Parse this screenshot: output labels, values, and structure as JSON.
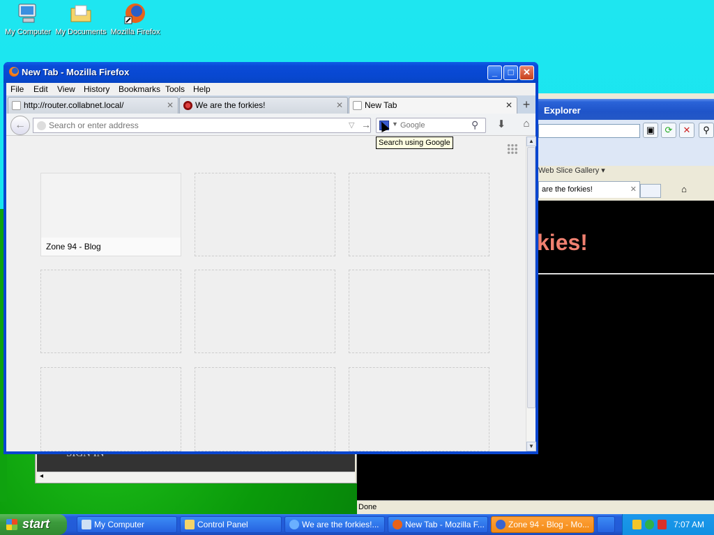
{
  "desktop": {
    "icons": [
      {
        "label": "My Computer"
      },
      {
        "label": "My Documents"
      },
      {
        "label": "Mozilla Firefox"
      }
    ]
  },
  "ie_window": {
    "title": "Explorer",
    "links_label": "Web Slice Gallery",
    "tab_title": "are the forkies!",
    "page_heading": "kies!",
    "status": "Done"
  },
  "zone_window": {
    "sign_in": "SIGN IN"
  },
  "firefox": {
    "title": "New Tab - Mozilla Firefox",
    "menu": [
      "File",
      "Edit",
      "View",
      "History",
      "Bookmarks",
      "Tools",
      "Help"
    ],
    "tabs": [
      {
        "title": "http://router.collabnet.local/"
      },
      {
        "title": "We are the forkies!"
      },
      {
        "title": "New Tab"
      }
    ],
    "url_placeholder": "Search or enter address",
    "search_placeholder": "Google",
    "tooltip": "Search using Google",
    "tiles": [
      {
        "label": "Zone 94 - Blog"
      }
    ]
  },
  "taskbar": {
    "start_label": "start",
    "tasks": [
      {
        "label": "My Computer"
      },
      {
        "label": "Control Panel"
      },
      {
        "label": "We are the forkies!..."
      },
      {
        "label": "New Tab - Mozilla F..."
      },
      {
        "label": "Zone 94 - Blog - Mo..."
      }
    ],
    "clock": "7:07 AM"
  },
  "colors": {
    "desktop_bg": "#15e4ee",
    "xp_title_blue": "#0848d0",
    "taskbar_blue": "#225bd6",
    "start_green": "#3b9a3b",
    "heading_salmon": "#f08070"
  },
  "icons": [
    "computer-icon",
    "folder-icon",
    "firefox-icon",
    "back-icon",
    "home-icon",
    "download-icon",
    "search-icon",
    "grid-icon"
  ]
}
